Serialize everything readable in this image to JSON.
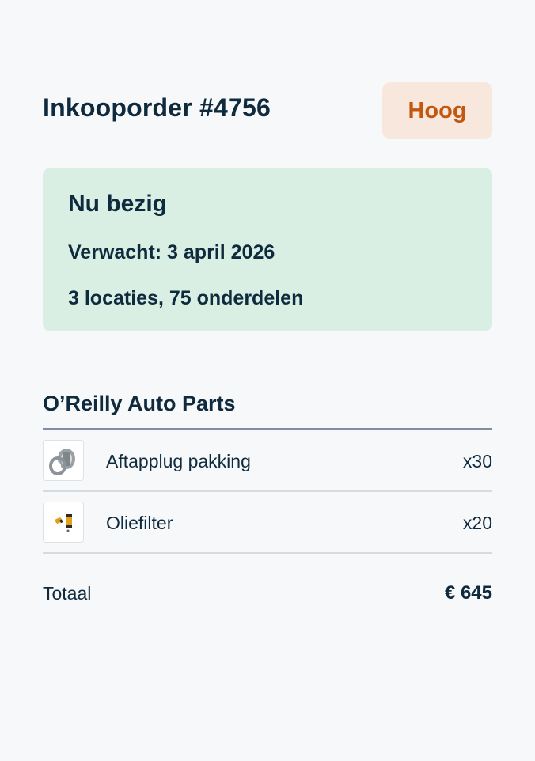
{
  "order": {
    "title": "Inkooporder #4756",
    "priority": "Hoog"
  },
  "status": {
    "title": "Nu bezig",
    "expected": "Verwacht: 3 april 2026",
    "summary": "3 locaties, 75 onderdelen"
  },
  "supplier": {
    "name": "O’Reilly Auto Parts",
    "items": [
      {
        "name": "Aftapplug pakking",
        "qty": "x30",
        "icon": "washer-icon"
      },
      {
        "name": "Oliefilter",
        "qty": "x20",
        "icon": "oil-filter-icon"
      }
    ]
  },
  "total": {
    "label": "Totaal",
    "value": "€ 645"
  },
  "colors": {
    "background": "#f7f8fa",
    "text": "#0f2a3d",
    "priority_bg": "#f8e7dd",
    "priority_text": "#c2570f",
    "status_bg": "#d9efe4"
  }
}
